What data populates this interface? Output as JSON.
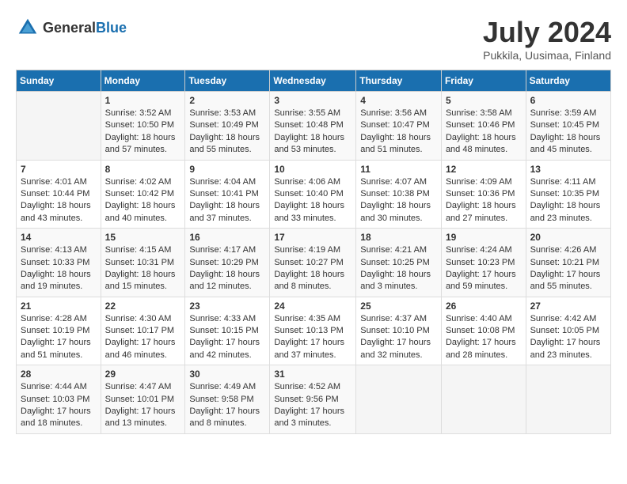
{
  "header": {
    "logo_general": "General",
    "logo_blue": "Blue",
    "title": "July 2024",
    "subtitle": "Pukkila, Uusimaa, Finland"
  },
  "days_of_week": [
    "Sunday",
    "Monday",
    "Tuesday",
    "Wednesday",
    "Thursday",
    "Friday",
    "Saturday"
  ],
  "weeks": [
    [
      {
        "day": "",
        "sunrise": "",
        "sunset": "",
        "daylight": ""
      },
      {
        "day": "1",
        "sunrise": "Sunrise: 3:52 AM",
        "sunset": "Sunset: 10:50 PM",
        "daylight": "Daylight: 18 hours and 57 minutes."
      },
      {
        "day": "2",
        "sunrise": "Sunrise: 3:53 AM",
        "sunset": "Sunset: 10:49 PM",
        "daylight": "Daylight: 18 hours and 55 minutes."
      },
      {
        "day": "3",
        "sunrise": "Sunrise: 3:55 AM",
        "sunset": "Sunset: 10:48 PM",
        "daylight": "Daylight: 18 hours and 53 minutes."
      },
      {
        "day": "4",
        "sunrise": "Sunrise: 3:56 AM",
        "sunset": "Sunset: 10:47 PM",
        "daylight": "Daylight: 18 hours and 51 minutes."
      },
      {
        "day": "5",
        "sunrise": "Sunrise: 3:58 AM",
        "sunset": "Sunset: 10:46 PM",
        "daylight": "Daylight: 18 hours and 48 minutes."
      },
      {
        "day": "6",
        "sunrise": "Sunrise: 3:59 AM",
        "sunset": "Sunset: 10:45 PM",
        "daylight": "Daylight: 18 hours and 45 minutes."
      }
    ],
    [
      {
        "day": "7",
        "sunrise": "Sunrise: 4:01 AM",
        "sunset": "Sunset: 10:44 PM",
        "daylight": "Daylight: 18 hours and 43 minutes."
      },
      {
        "day": "8",
        "sunrise": "Sunrise: 4:02 AM",
        "sunset": "Sunset: 10:42 PM",
        "daylight": "Daylight: 18 hours and 40 minutes."
      },
      {
        "day": "9",
        "sunrise": "Sunrise: 4:04 AM",
        "sunset": "Sunset: 10:41 PM",
        "daylight": "Daylight: 18 hours and 37 minutes."
      },
      {
        "day": "10",
        "sunrise": "Sunrise: 4:06 AM",
        "sunset": "Sunset: 10:40 PM",
        "daylight": "Daylight: 18 hours and 33 minutes."
      },
      {
        "day": "11",
        "sunrise": "Sunrise: 4:07 AM",
        "sunset": "Sunset: 10:38 PM",
        "daylight": "Daylight: 18 hours and 30 minutes."
      },
      {
        "day": "12",
        "sunrise": "Sunrise: 4:09 AM",
        "sunset": "Sunset: 10:36 PM",
        "daylight": "Daylight: 18 hours and 27 minutes."
      },
      {
        "day": "13",
        "sunrise": "Sunrise: 4:11 AM",
        "sunset": "Sunset: 10:35 PM",
        "daylight": "Daylight: 18 hours and 23 minutes."
      }
    ],
    [
      {
        "day": "14",
        "sunrise": "Sunrise: 4:13 AM",
        "sunset": "Sunset: 10:33 PM",
        "daylight": "Daylight: 18 hours and 19 minutes."
      },
      {
        "day": "15",
        "sunrise": "Sunrise: 4:15 AM",
        "sunset": "Sunset: 10:31 PM",
        "daylight": "Daylight: 18 hours and 15 minutes."
      },
      {
        "day": "16",
        "sunrise": "Sunrise: 4:17 AM",
        "sunset": "Sunset: 10:29 PM",
        "daylight": "Daylight: 18 hours and 12 minutes."
      },
      {
        "day": "17",
        "sunrise": "Sunrise: 4:19 AM",
        "sunset": "Sunset: 10:27 PM",
        "daylight": "Daylight: 18 hours and 8 minutes."
      },
      {
        "day": "18",
        "sunrise": "Sunrise: 4:21 AM",
        "sunset": "Sunset: 10:25 PM",
        "daylight": "Daylight: 18 hours and 3 minutes."
      },
      {
        "day": "19",
        "sunrise": "Sunrise: 4:24 AM",
        "sunset": "Sunset: 10:23 PM",
        "daylight": "Daylight: 17 hours and 59 minutes."
      },
      {
        "day": "20",
        "sunrise": "Sunrise: 4:26 AM",
        "sunset": "Sunset: 10:21 PM",
        "daylight": "Daylight: 17 hours and 55 minutes."
      }
    ],
    [
      {
        "day": "21",
        "sunrise": "Sunrise: 4:28 AM",
        "sunset": "Sunset: 10:19 PM",
        "daylight": "Daylight: 17 hours and 51 minutes."
      },
      {
        "day": "22",
        "sunrise": "Sunrise: 4:30 AM",
        "sunset": "Sunset: 10:17 PM",
        "daylight": "Daylight: 17 hours and 46 minutes."
      },
      {
        "day": "23",
        "sunrise": "Sunrise: 4:33 AM",
        "sunset": "Sunset: 10:15 PM",
        "daylight": "Daylight: 17 hours and 42 minutes."
      },
      {
        "day": "24",
        "sunrise": "Sunrise: 4:35 AM",
        "sunset": "Sunset: 10:13 PM",
        "daylight": "Daylight: 17 hours and 37 minutes."
      },
      {
        "day": "25",
        "sunrise": "Sunrise: 4:37 AM",
        "sunset": "Sunset: 10:10 PM",
        "daylight": "Daylight: 17 hours and 32 minutes."
      },
      {
        "day": "26",
        "sunrise": "Sunrise: 4:40 AM",
        "sunset": "Sunset: 10:08 PM",
        "daylight": "Daylight: 17 hours and 28 minutes."
      },
      {
        "day": "27",
        "sunrise": "Sunrise: 4:42 AM",
        "sunset": "Sunset: 10:05 PM",
        "daylight": "Daylight: 17 hours and 23 minutes."
      }
    ],
    [
      {
        "day": "28",
        "sunrise": "Sunrise: 4:44 AM",
        "sunset": "Sunset: 10:03 PM",
        "daylight": "Daylight: 17 hours and 18 minutes."
      },
      {
        "day": "29",
        "sunrise": "Sunrise: 4:47 AM",
        "sunset": "Sunset: 10:01 PM",
        "daylight": "Daylight: 17 hours and 13 minutes."
      },
      {
        "day": "30",
        "sunrise": "Sunrise: 4:49 AM",
        "sunset": "Sunset: 9:58 PM",
        "daylight": "Daylight: 17 hours and 8 minutes."
      },
      {
        "day": "31",
        "sunrise": "Sunrise: 4:52 AM",
        "sunset": "Sunset: 9:56 PM",
        "daylight": "Daylight: 17 hours and 3 minutes."
      },
      {
        "day": "",
        "sunrise": "",
        "sunset": "",
        "daylight": ""
      },
      {
        "day": "",
        "sunrise": "",
        "sunset": "",
        "daylight": ""
      },
      {
        "day": "",
        "sunrise": "",
        "sunset": "",
        "daylight": ""
      }
    ]
  ]
}
